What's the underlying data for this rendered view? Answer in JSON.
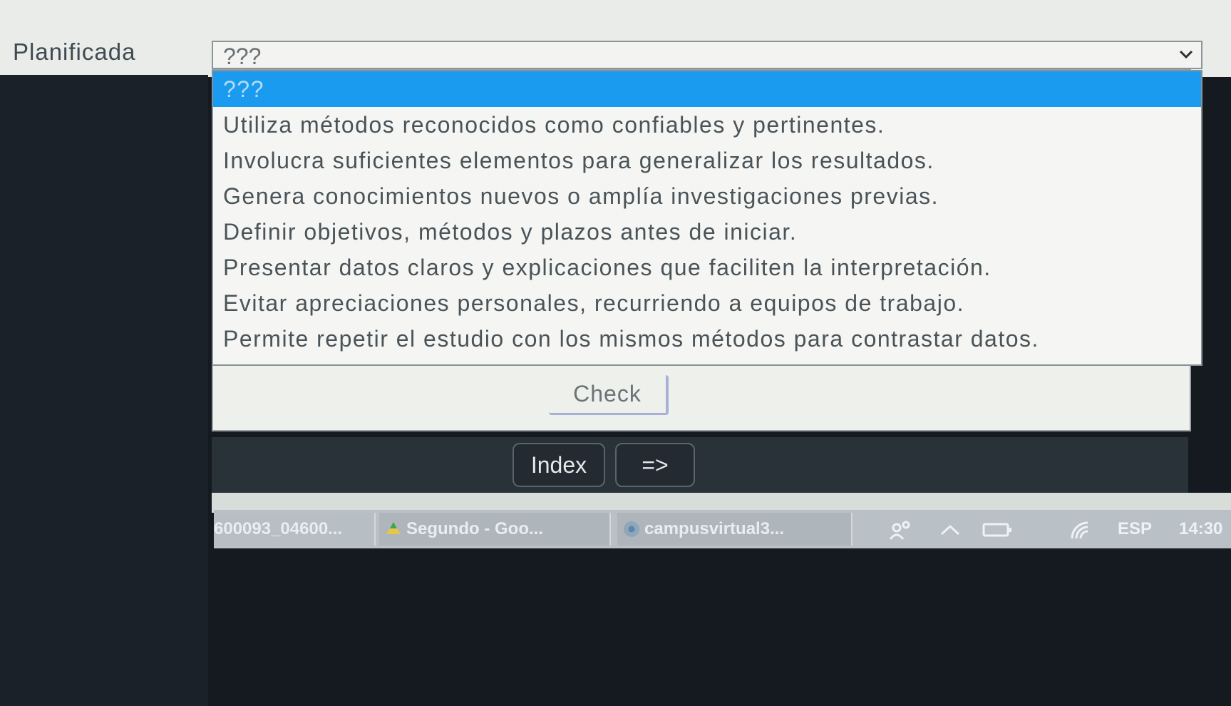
{
  "form": {
    "label": "Planificada",
    "select": {
      "value": "???",
      "options": [
        "???",
        "Utiliza métodos reconocidos como confiables y pertinentes.",
        "Involucra suficientes elementos para generalizar los resultados.",
        "Genera conocimientos nuevos o amplía investigaciones previas.",
        "Definir objetivos, métodos y plazos antes de iniciar.",
        "Presentar datos claros y explicaciones que faciliten la interpretación.",
        "Evitar apreciaciones personales, recurriendo a equipos de trabajo.",
        "Permite repetir el estudio con los mismos métodos para contrastar datos."
      ],
      "selected_index": 0
    },
    "check_label": "Check"
  },
  "nav": {
    "index_label": "Index",
    "next_label": "=>"
  },
  "taskbar": {
    "items": [
      {
        "label": "600093_04600...",
        "icon": "file-icon"
      },
      {
        "label": "Segundo - Goo...",
        "icon": "google-drive-icon"
      },
      {
        "label": "campusvirtual3...",
        "icon": "chrome-icon"
      }
    ],
    "tray": {
      "language": "ESP",
      "clock": "14:30"
    }
  },
  "colors": {
    "selected_option": "#1a9bf0",
    "nav_bar": "#293139",
    "taskbar": "#b9c1c6"
  }
}
